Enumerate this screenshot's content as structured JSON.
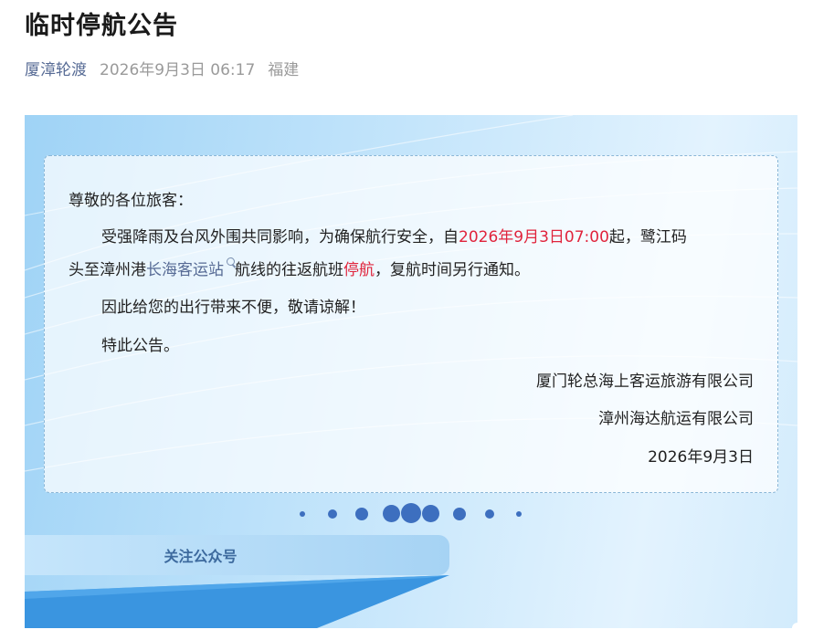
{
  "article": {
    "title": "临时停航公告",
    "account": "厦漳轮渡",
    "datetime": "2026年9月3日 06:17",
    "location": "福建"
  },
  "notice": {
    "greeting": "尊敬的各位旅客：",
    "line1_prefix": "受强降雨及台风外围共同影响，为确保航行安全，自",
    "line1_time": "2026年9月3日07:00",
    "line1_suffix": "起，鹭江码",
    "line2_prefix": "头至漳州港",
    "line2_link": "长海客运站",
    "line2_mid": "航线的往返航班",
    "line2_highlight": "停航",
    "line2_suffix": "，复航时间另行通知。",
    "apology": "因此给您的出行带来不便，敬请谅解！",
    "closing": "特此公告。",
    "signatory1": "厦门轮总海上客运旅游有限公司",
    "signatory2": "漳州海达航运有限公司",
    "sign_date": "2026年9月3日"
  },
  "footer": {
    "follow_label": "关注公众号"
  },
  "colors": {
    "accent_red": "#e0243c",
    "link_blue": "#576b95",
    "dot_blue": "#3d6fbf",
    "stripe_blue": "#3a95e0"
  },
  "icons": {
    "search": "search-icon"
  }
}
